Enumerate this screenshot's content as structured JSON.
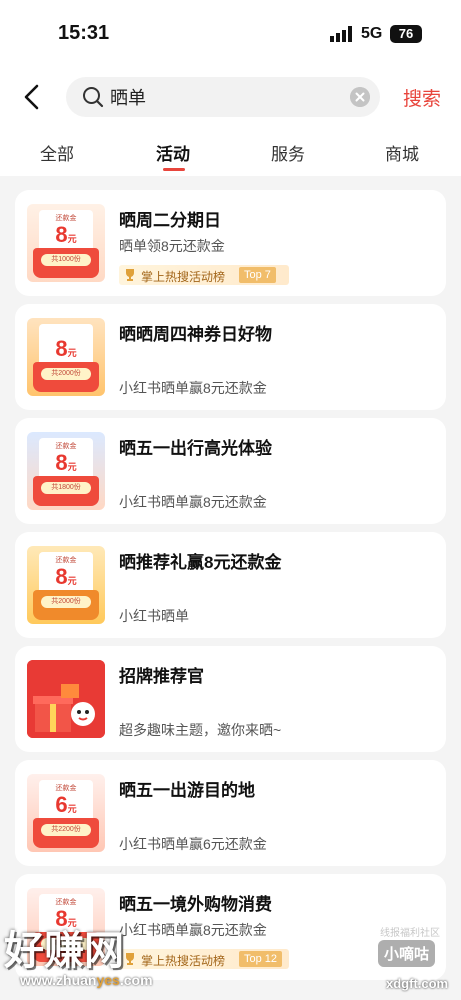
{
  "status_bar": {
    "time": "15:31",
    "network": "5G",
    "battery": "76"
  },
  "header": {
    "search_value": "晒单",
    "search_button": "搜索"
  },
  "tabs": [
    {
      "label": "全部",
      "active": false
    },
    {
      "label": "活动",
      "active": true
    },
    {
      "label": "服务",
      "active": false
    },
    {
      "label": "商城",
      "active": false
    }
  ],
  "cards": [
    {
      "title": "晒周二分期日",
      "desc": "晒单领8元还款金",
      "thumb_label": "还款金",
      "thumb_amount": "8",
      "thumb_unit": "元",
      "thumb_count": "共1000份",
      "rank_text": "掌上热搜活动榜",
      "rank_pill": "Top 7"
    },
    {
      "title": "晒晒周四神券日好物",
      "desc": "小红书晒单赢8元还款金",
      "thumb_label": "",
      "thumb_amount": "8",
      "thumb_unit": "元",
      "thumb_count": "共2000份"
    },
    {
      "title": "晒五一出行高光体验",
      "desc": "小红书晒单赢8元还款金",
      "thumb_label": "还款金",
      "thumb_amount": "8",
      "thumb_unit": "元",
      "thumb_count": "共1800份"
    },
    {
      "title": "晒推荐礼赢8元还款金",
      "desc": "小红书晒单",
      "thumb_label": "还款金",
      "thumb_amount": "8",
      "thumb_unit": "元",
      "thumb_count": "共2000份"
    },
    {
      "title": "招牌推荐官",
      "desc": "超多趣味主题，邀你来晒~"
    },
    {
      "title": "晒五一出游目的地",
      "desc": "小红书晒单赢6元还款金",
      "thumb_label": "还款金",
      "thumb_amount": "6",
      "thumb_unit": "元",
      "thumb_count": "共2200份"
    },
    {
      "title": "晒五一境外购物消费",
      "desc": "小红书晒单赢8元还款金",
      "thumb_label": "还款金",
      "thumb_amount": "8",
      "thumb_unit": "元",
      "thumb_count": "共1200份",
      "rank_text": "掌上热搜活动榜",
      "rank_pill": "Top 12"
    }
  ],
  "watermark": {
    "brand": "好赚网",
    "url_prefix": "www.zhuan",
    "url_highlight": "yes",
    "url_suffix": ".com",
    "tag": "线报福利社区",
    "logo": "小嘀咕",
    "site": "xdgft.com"
  },
  "colors": {
    "accent": "#e8453c",
    "rank_pill": "#f1bd6a"
  }
}
